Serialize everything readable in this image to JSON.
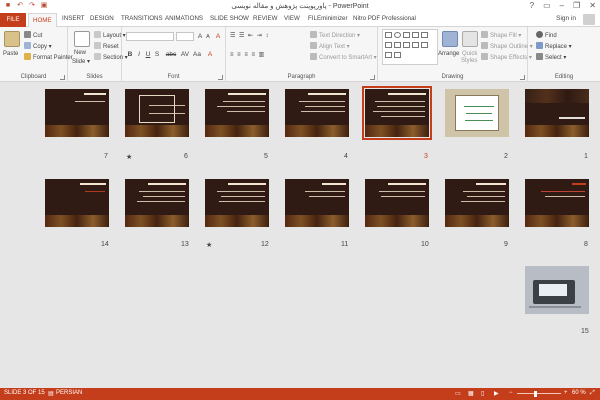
{
  "window": {
    "title": "پاورپوینت پژوهش و مقاله نویسی - PowerPoint",
    "help": "?",
    "min": "–",
    "restore": "❐",
    "close": "✕"
  },
  "qat": {
    "save_icon": "save-icon",
    "undo_icon": "undo-icon",
    "redo_icon": "redo-icon",
    "start_icon": "start-from-beginning-icon"
  },
  "tabs": [
    {
      "label": "FILE"
    },
    {
      "label": "HOME"
    },
    {
      "label": "INSERT"
    },
    {
      "label": "DESIGN"
    },
    {
      "label": "TRANSITIONS"
    },
    {
      "label": "ANIMATIONS"
    },
    {
      "label": "SLIDE SHOW"
    },
    {
      "label": "REVIEW"
    },
    {
      "label": "VIEW"
    },
    {
      "label": "FILEminimizer"
    },
    {
      "label": "Nitro PDF Professional"
    }
  ],
  "signin": "Sign in",
  "ribbon": {
    "clipboard": {
      "paste": "Paste",
      "cut": "Cut",
      "copy": "Copy",
      "format_painter": "Format Painter",
      "label": "Clipboard"
    },
    "slides": {
      "new_slide_1": "New",
      "new_slide_2": "Slide",
      "layout": "Layout",
      "reset": "Reset",
      "section": "Section",
      "label": "Slides"
    },
    "font": {
      "bold": "B",
      "italic": "I",
      "underline": "U",
      "strike": "S",
      "shadow": "abc",
      "spacing": "AV",
      "case": "Aa",
      "grow": "A",
      "shrink": "A",
      "clear": "A",
      "color": "A",
      "label": "Font"
    },
    "paragraph": {
      "text_direction": "Text Direction",
      "align_text": "Align Text",
      "convert_smartart": "Convert to SmartArt",
      "label": "Paragraph"
    },
    "drawing": {
      "arrange": "Arrange",
      "quick_styles_1": "Quick",
      "quick_styles_2": "Styles",
      "shape_fill": "Shape Fill",
      "shape_outline": "Shape Outline",
      "shape_effects": "Shape Effects",
      "label": "Drawing"
    },
    "editing": {
      "find": "Find",
      "replace": "Replace",
      "select": "Select",
      "label": "Editing"
    }
  },
  "slides": [
    {
      "num": "1"
    },
    {
      "num": "2"
    },
    {
      "num": "3"
    },
    {
      "num": "4"
    },
    {
      "num": "5"
    },
    {
      "num": "6"
    },
    {
      "num": "7"
    },
    {
      "num": "8"
    },
    {
      "num": "9"
    },
    {
      "num": "10"
    },
    {
      "num": "11"
    },
    {
      "num": "12"
    },
    {
      "num": "13"
    },
    {
      "num": "14"
    },
    {
      "num": "15"
    }
  ],
  "slide_marks": {
    "star_6": "★",
    "star_12": "★"
  },
  "status": {
    "slide_info": "SLIDE 3 OF 15",
    "language": "PERSIAN",
    "zoom": "60 %"
  },
  "colors": {
    "accent": "#c43e1c",
    "selected_slide_border": "#c43e1c"
  }
}
